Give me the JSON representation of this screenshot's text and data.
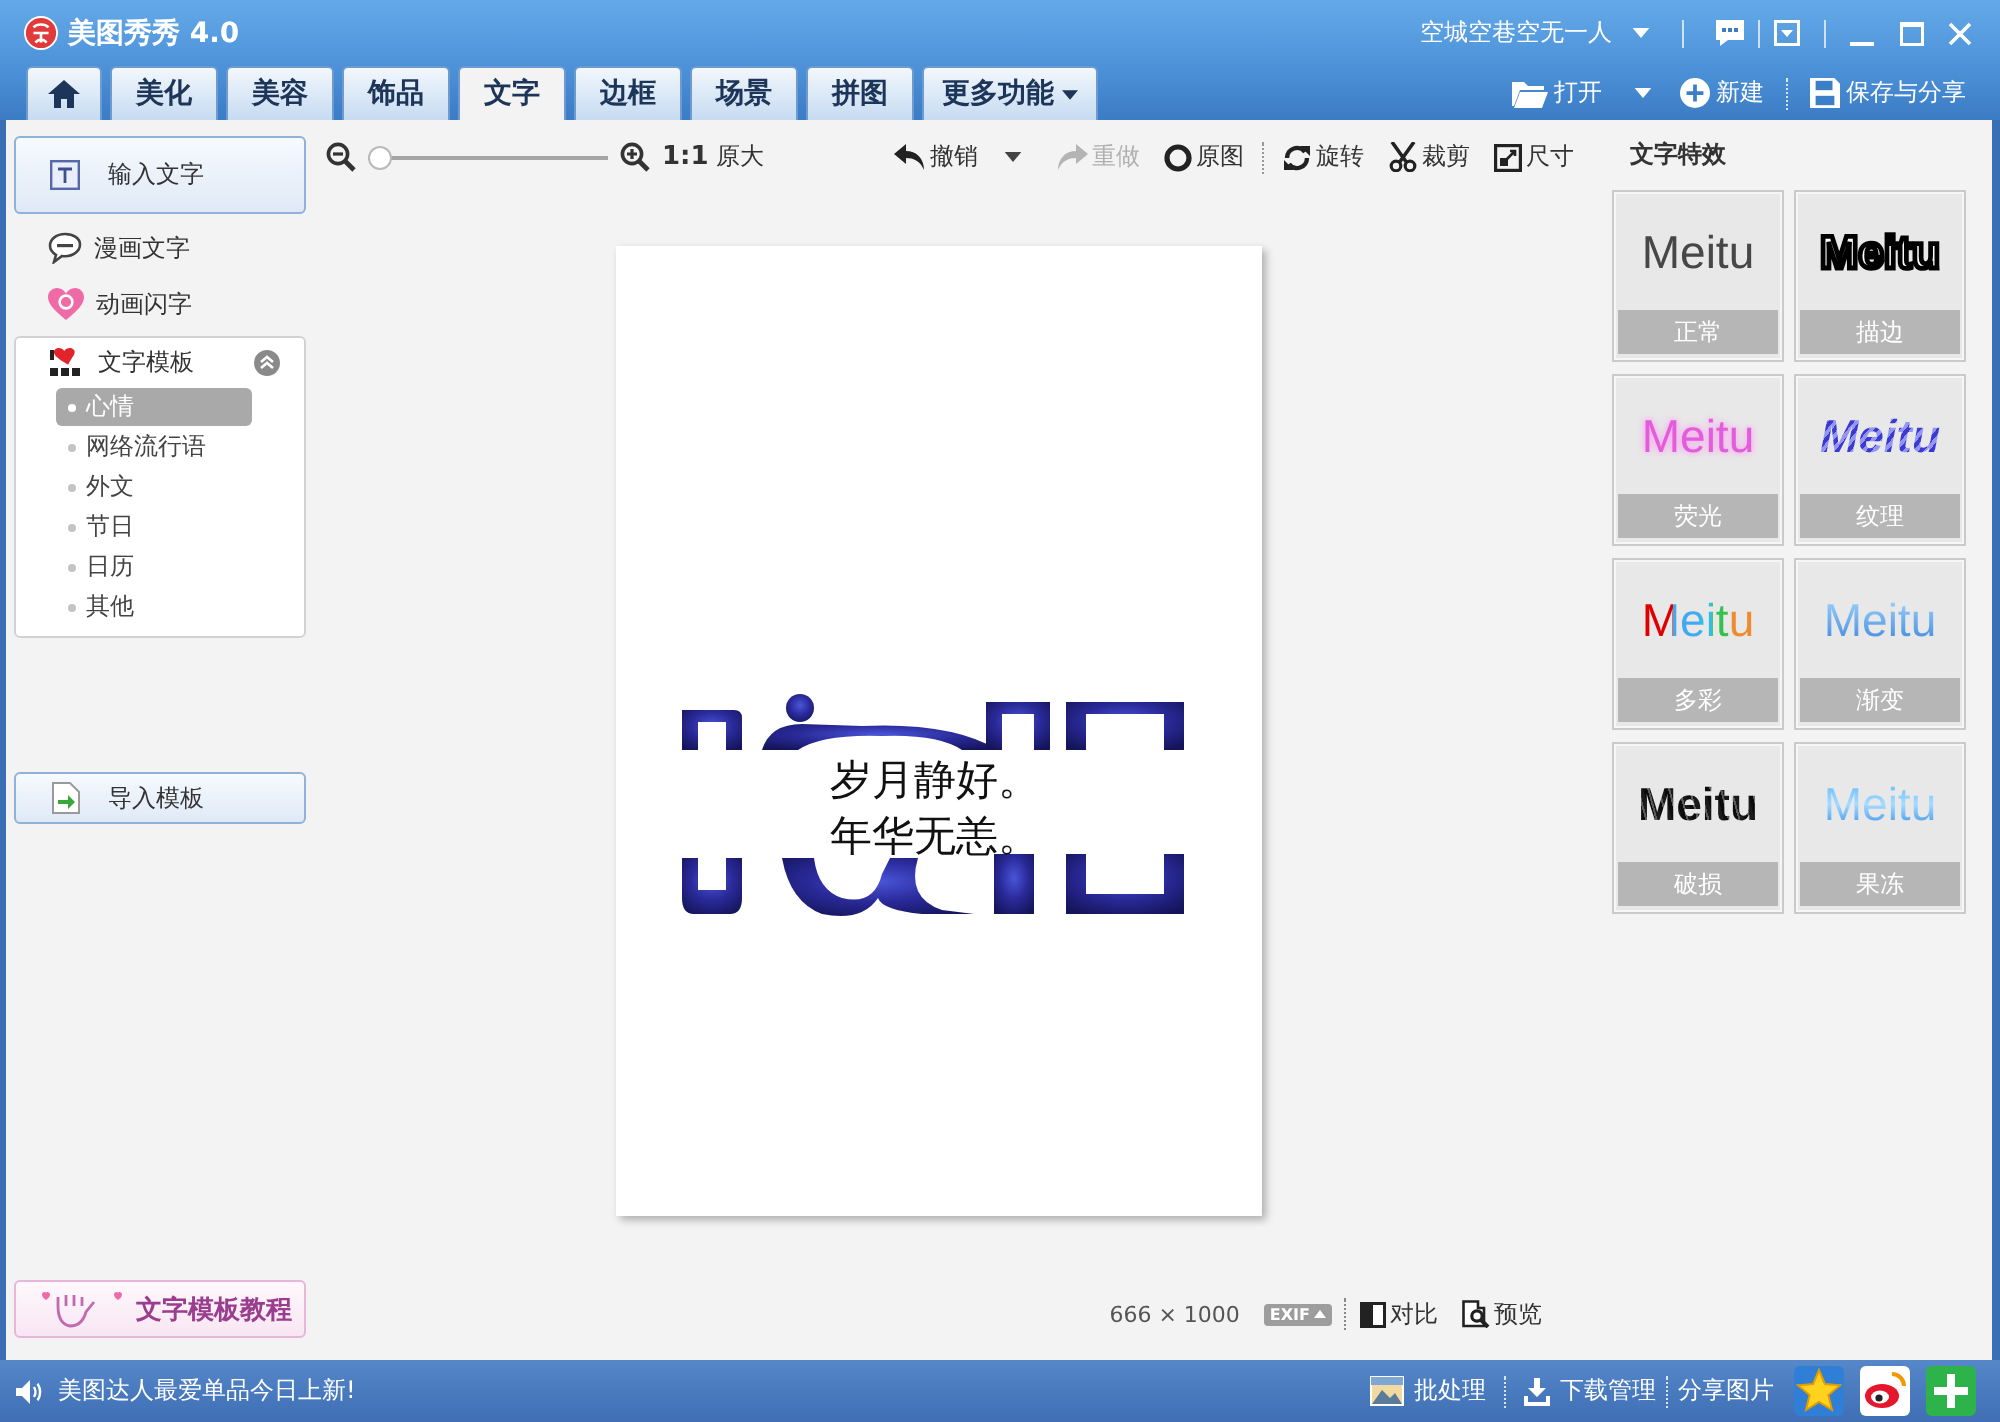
{
  "window": {
    "title": "美图秀秀 4.0",
    "user": "空城空巷空无一人"
  },
  "tabs": [
    {
      "kind": "home",
      "selected": false
    },
    {
      "kind": "text",
      "label": "美化",
      "selected": false
    },
    {
      "kind": "text",
      "label": "美容",
      "selected": false
    },
    {
      "kind": "text",
      "label": "饰品",
      "selected": false
    },
    {
      "kind": "text",
      "label": "文字",
      "selected": true
    },
    {
      "kind": "text",
      "label": "边框",
      "selected": false
    },
    {
      "kind": "text",
      "label": "场景",
      "selected": false
    },
    {
      "kind": "text",
      "label": "拼图",
      "selected": false
    },
    {
      "kind": "menu",
      "label": "更多功能",
      "selected": false
    }
  ],
  "file_actions": [
    {
      "kind": "open",
      "label": "打开"
    },
    {
      "kind": "new",
      "label": "新建"
    },
    {
      "kind": "save",
      "label": "保存与分享"
    }
  ],
  "sidebar": {
    "input_button": "输入文字",
    "items": [
      {
        "kind": "comic",
        "label": "漫画文字"
      },
      {
        "kind": "flash",
        "label": "动画闪字"
      }
    ],
    "templates": {
      "title": "文字模板",
      "expanded": true,
      "items": [
        {
          "label": "心情",
          "selected": true
        },
        {
          "label": "网络流行语",
          "selected": false
        },
        {
          "label": "外文",
          "selected": false
        },
        {
          "label": "节日",
          "selected": false
        },
        {
          "label": "日历",
          "selected": false
        },
        {
          "label": "其他",
          "selected": false
        }
      ]
    },
    "import_button": "导入模板",
    "tutorial_button": "文字模板教程"
  },
  "toolbar": {
    "zoom": {
      "level": 0
    },
    "actual_size": "**1:1** 原大",
    "groups": [
      [
        {
          "kind": "undo",
          "label": "撤销",
          "disabled": false
        },
        {
          "kind": "redo",
          "label": "重做",
          "disabled": true
        },
        {
          "kind": "original",
          "label": "原图",
          "disabled": false
        }
      ],
      [
        {
          "kind": "rotate",
          "label": "旋转",
          "disabled": false
        },
        {
          "kind": "crop",
          "label": "裁剪",
          "disabled": false
        },
        {
          "kind": "resize",
          "label": "尺寸",
          "disabled": false
        }
      ]
    ]
  },
  "canvas": {
    "lines": [
      "岁月静好。",
      "年华无恙。"
    ]
  },
  "image_info": {
    "size": "666 × 1000",
    "exif": "EXIF",
    "compare": "对比",
    "preview": "预览"
  },
  "effects": {
    "title": "文字特效",
    "items": [
      {
        "kind": "normal",
        "sample": "Meitu",
        "label": "正常"
      },
      {
        "kind": "outline",
        "sample": "Meitu",
        "label": "描边"
      },
      {
        "kind": "glow",
        "sample": "Meitu",
        "label": "荧光"
      },
      {
        "kind": "texture",
        "sample": "Meitu",
        "label": "纹理"
      },
      {
        "kind": "multicolor",
        "sample": "Meitu",
        "label": "多彩"
      },
      {
        "kind": "gradient",
        "sample": "Meitu",
        "label": "渐变"
      },
      {
        "kind": "damaged",
        "sample": "Meitu",
        "label": "破损"
      },
      {
        "kind": "frozen",
        "sample": "Meitu",
        "label": "果冻"
      }
    ]
  },
  "status_bar": {
    "message": "美图达人最爱单品今日上新!",
    "actions": [
      {
        "kind": "batch",
        "label": "批处理"
      },
      {
        "kind": "download",
        "label": "下载管理"
      },
      {
        "kind": "share",
        "label": "分享图片"
      }
    ],
    "apps": [
      {
        "kind": "star"
      },
      {
        "kind": "weibo"
      },
      {
        "kind": "add"
      }
    ]
  }
}
